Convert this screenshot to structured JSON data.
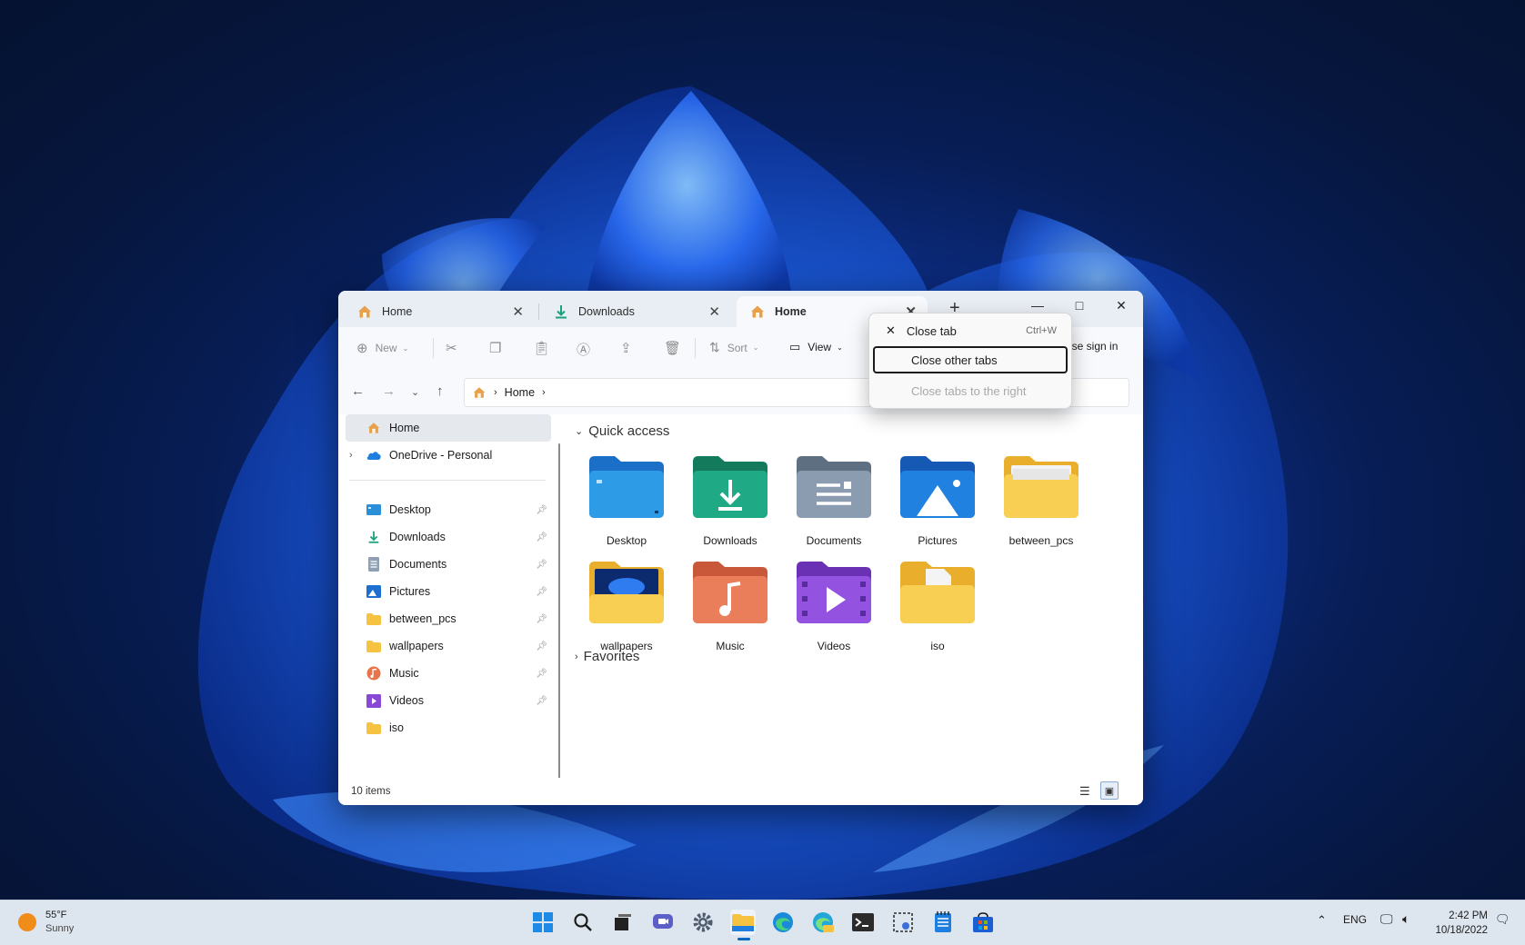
{
  "window": {
    "tabs": [
      {
        "label": "Home",
        "icon": "home-icon",
        "active": false
      },
      {
        "label": "Downloads",
        "icon": "download-icon",
        "active": false
      },
      {
        "label": "Home",
        "icon": "home-icon",
        "active": true
      }
    ],
    "new_tab": "+",
    "caption": {
      "minimize": "—",
      "maximize": "□",
      "close": "✕"
    }
  },
  "toolbar": {
    "new_label": "New",
    "sort_label": "Sort",
    "view_label": "View",
    "signin_text": "ase sign in"
  },
  "address": {
    "crumbs": [
      "Home"
    ]
  },
  "context_menu": {
    "items": [
      {
        "label": "Close tab",
        "shortcut": "Ctrl+W",
        "state": "normal"
      },
      {
        "label": "Close other tabs",
        "state": "focused"
      },
      {
        "label": "Close tabs to the right",
        "state": "disabled"
      }
    ]
  },
  "sidebar": {
    "top": [
      {
        "label": "Home",
        "icon": "home-icon",
        "selected": true
      },
      {
        "label": "OneDrive - Personal",
        "icon": "onedrive-icon",
        "expandable": true
      }
    ],
    "pinned": [
      {
        "label": "Desktop",
        "icon": "desktop-folder-icon"
      },
      {
        "label": "Downloads",
        "icon": "download-icon"
      },
      {
        "label": "Documents",
        "icon": "documents-icon"
      },
      {
        "label": "Pictures",
        "icon": "pictures-icon"
      },
      {
        "label": "between_pcs",
        "icon": "folder-icon"
      },
      {
        "label": "wallpapers",
        "icon": "folder-icon"
      },
      {
        "label": "Music",
        "icon": "music-icon"
      },
      {
        "label": "Videos",
        "icon": "videos-icon"
      },
      {
        "label": "iso",
        "icon": "folder-icon"
      }
    ]
  },
  "content": {
    "quick_access_label": "Quick access",
    "favorites_label": "Favorites",
    "folders": [
      {
        "label": "Desktop",
        "icon": "desktop-folder-icon"
      },
      {
        "label": "Downloads",
        "icon": "downloads-folder-icon"
      },
      {
        "label": "Documents",
        "icon": "documents-folder-icon"
      },
      {
        "label": "Pictures",
        "icon": "pictures-folder-icon"
      },
      {
        "label": "between_pcs",
        "icon": "folder-icon"
      },
      {
        "label": "wallpapers",
        "icon": "folder-icon"
      },
      {
        "label": "Music",
        "icon": "music-folder-icon"
      },
      {
        "label": "Videos",
        "icon": "videos-folder-icon"
      },
      {
        "label": "iso",
        "icon": "folder-icon"
      }
    ]
  },
  "status": {
    "items_text": "10 items"
  },
  "taskbar": {
    "weather": {
      "temp": "55°F",
      "condition": "Sunny"
    },
    "lang": "ENG",
    "time": "2:42 PM",
    "date": "10/18/2022"
  },
  "colors": {
    "accent": "#0067c0",
    "folder_yellow": "#f8cf53",
    "desktop_blue": "#2a8fd8",
    "downloads_teal": "#1aa17b",
    "music_orange": "#e8744b",
    "videos_purple": "#8a48d6"
  }
}
